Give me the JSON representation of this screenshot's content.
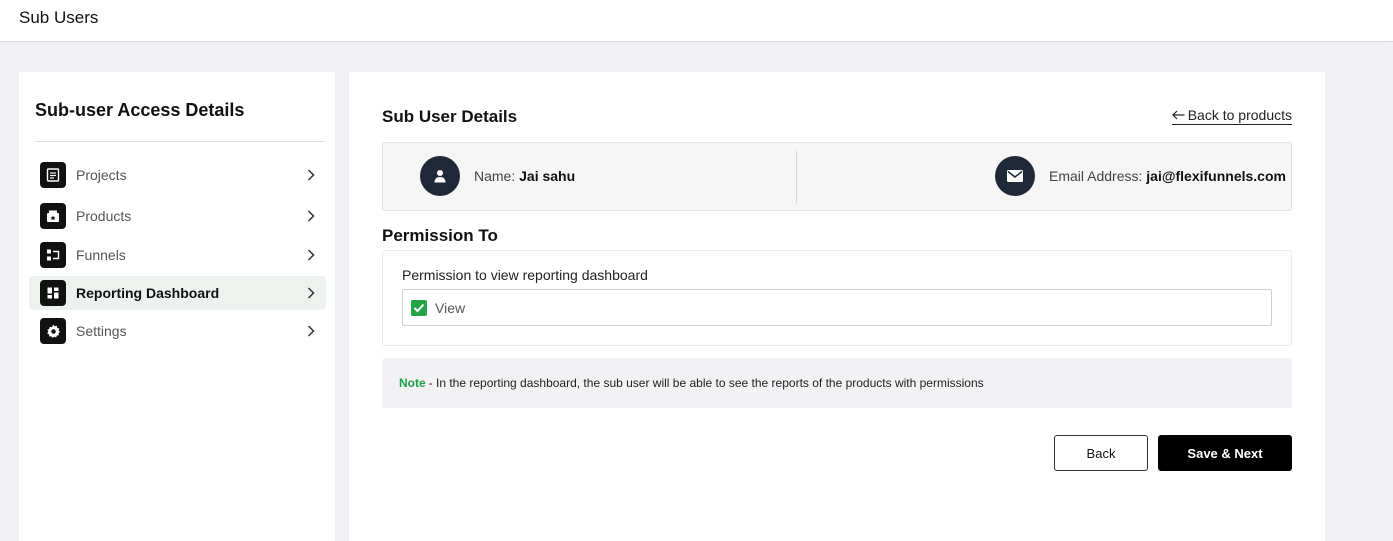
{
  "topbar": {
    "title": "Sub Users"
  },
  "sidebar": {
    "heading": "Sub-user Access Details",
    "items": [
      {
        "label": "Projects",
        "icon": "document-list-icon",
        "active": false
      },
      {
        "label": "Products",
        "icon": "product-box-icon",
        "active": false
      },
      {
        "label": "Funnels",
        "icon": "funnel-flow-icon",
        "active": false
      },
      {
        "label": "Reporting Dashboard",
        "icon": "dashboard-grid-icon",
        "active": true
      },
      {
        "label": "Settings",
        "icon": "gear-icon",
        "active": false
      }
    ]
  },
  "main": {
    "section_title": "Sub User Details",
    "back_link": "Back to products",
    "user": {
      "name_label": "Name:",
      "name_value": "Jai sahu",
      "email_label": "Email Address:",
      "email_value": "jai@flexifunnels.com"
    },
    "permission": {
      "title": "Permission To",
      "label": "Permission to view reporting dashboard",
      "option_label": "View",
      "checked": true
    },
    "note": {
      "key": "Note",
      "text": "- In the reporting dashboard, the sub user will be able to see the reports of the products with permissions"
    },
    "buttons": {
      "back": "Back",
      "save_next": "Save & Next"
    }
  },
  "colors": {
    "accent_green": "#22a447",
    "note_green": "#1e9e46",
    "dark": "#1f2937"
  }
}
